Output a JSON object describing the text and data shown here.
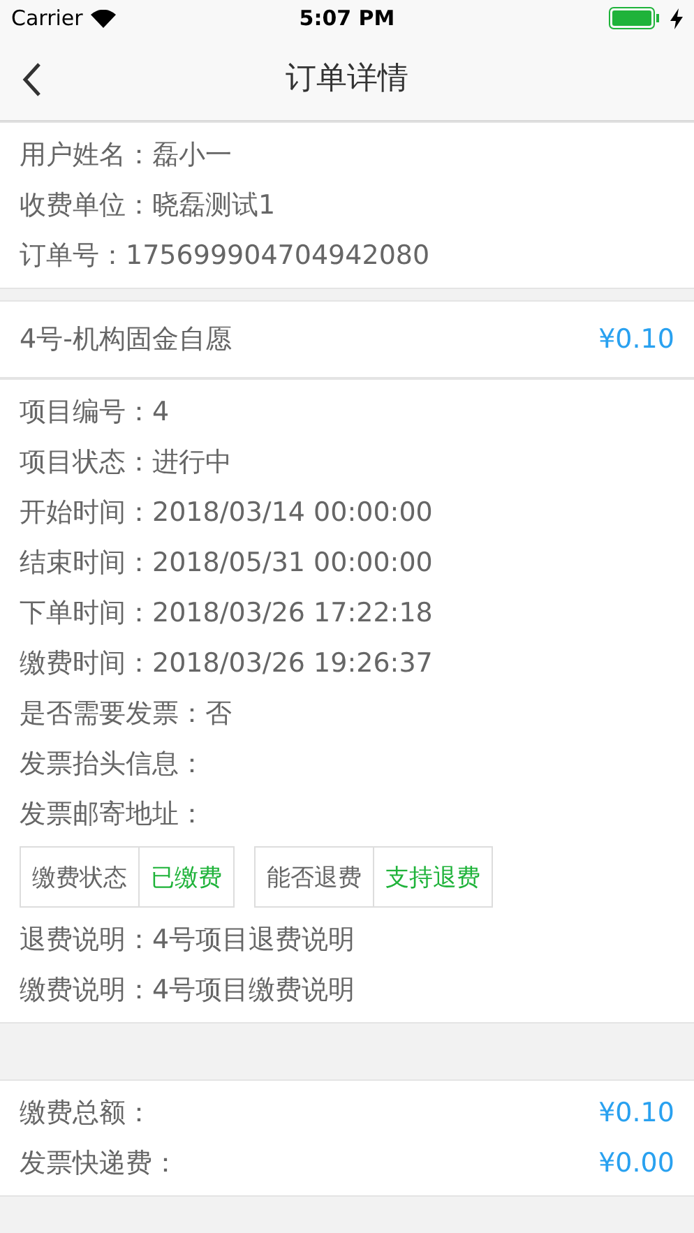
{
  "status_bar": {
    "carrier": "Carrier",
    "time": "5:07 PM"
  },
  "nav": {
    "title": "订单详情"
  },
  "user_info": [
    {
      "label": "用户姓名：",
      "value": "磊小一"
    },
    {
      "label": "收费单位：",
      "value": "晓磊测试1"
    },
    {
      "label": "订单号：",
      "value": "175699904704942080"
    }
  ],
  "item": {
    "name": "4号-机构固金自愿",
    "price": "¥0.10"
  },
  "details": [
    {
      "label": "项目编号：",
      "value": "4"
    },
    {
      "label": "项目状态：",
      "value": "进行中"
    },
    {
      "label": "开始时间：",
      "value": "2018/03/14 00:00:00"
    },
    {
      "label": "结束时间：",
      "value": "2018/05/31 00:00:00"
    },
    {
      "label": "下单时间：",
      "value": "2018/03/26 17:22:18"
    },
    {
      "label": "缴费时间：",
      "value": "2018/03/26 19:26:37"
    },
    {
      "label": "是否需要发票：",
      "value": "否"
    },
    {
      "label": "发票抬头信息："
    },
    {
      "label": "发票邮寄地址："
    }
  ],
  "tags": [
    {
      "label": "缴费状态",
      "value": "已缴费"
    },
    {
      "label": "能否退费",
      "value": "支持退费"
    }
  ],
  "notes": [
    {
      "label": "退费说明：",
      "value": "4号项目退费说明"
    },
    {
      "label": "缴费说明：",
      "value": "4号项目缴费说明"
    }
  ],
  "totals": [
    {
      "label": "缴费总额：",
      "value": "¥0.10"
    },
    {
      "label": "发票快递费：",
      "value": "¥0.00"
    }
  ]
}
